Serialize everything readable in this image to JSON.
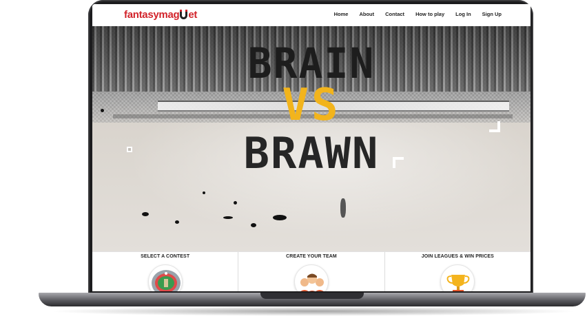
{
  "brand": {
    "logo_part_1": "fantasymag",
    "logo_part_2": "et",
    "logo_icon": "magnet-icon",
    "accent_color": "#d2232a"
  },
  "nav": {
    "items": [
      {
        "label": "Home"
      },
      {
        "label": "About"
      },
      {
        "label": "Contact"
      },
      {
        "label": "How to play"
      },
      {
        "label": "Log In"
      },
      {
        "label": "Sign Up"
      }
    ]
  },
  "hero": {
    "line_1": "BRAIN",
    "line_2": "VS",
    "line_3": "BRAWN",
    "highlight_color": "#f2b41c"
  },
  "steps": [
    {
      "title": "SELECT A CONTEST",
      "icon": "stadium-icon"
    },
    {
      "title": "CREATE YOUR TEAM",
      "icon": "team-icon"
    },
    {
      "title": "JOIN LEAGUES & WIN PRICES",
      "icon": "trophy-icon"
    }
  ]
}
